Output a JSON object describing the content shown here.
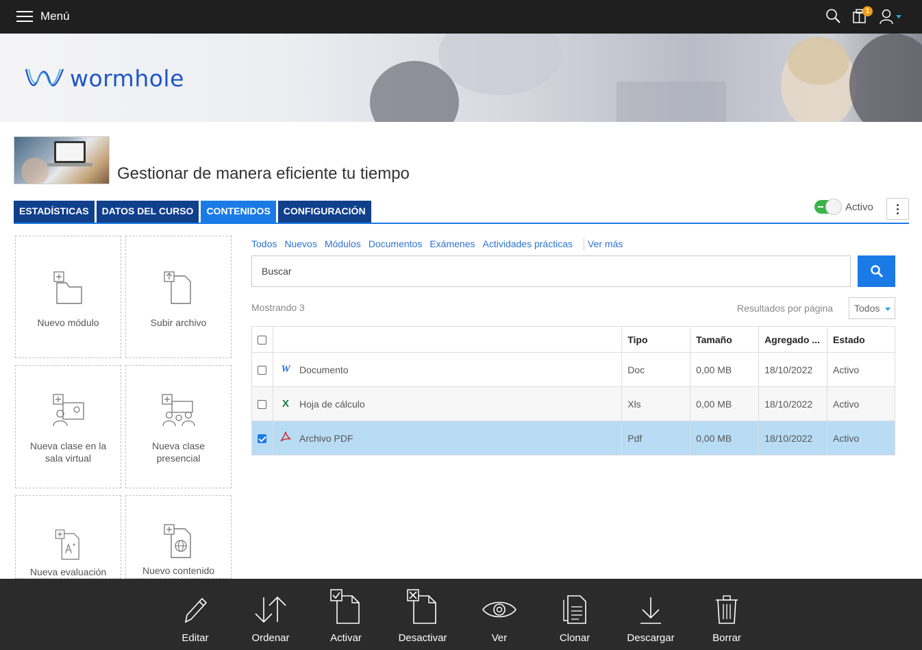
{
  "topbar": {
    "menu_label": "Menú",
    "notification_count": "1"
  },
  "banner": {
    "logo_text": "wormhole"
  },
  "course": {
    "title": "Gestionar de manera eficiente tu tiempo"
  },
  "tabs": [
    {
      "label": "ESTADÍSTICAS",
      "active": false
    },
    {
      "label": "DATOS DEL CURSO",
      "active": false
    },
    {
      "label": "CONTENIDOS",
      "active": true
    },
    {
      "label": "CONFIGURACIÓN",
      "active": false
    }
  ],
  "status_toggle": {
    "label": "Activo",
    "on": true
  },
  "actions": [
    {
      "label": "Nuevo módulo",
      "icon": "new-module-icon"
    },
    {
      "label": "Subir archivo",
      "icon": "upload-file-icon"
    },
    {
      "label": "Nueva clase en la sala virtual",
      "icon": "virtual-class-icon"
    },
    {
      "label": "Nueva clase presencial",
      "icon": "in-person-class-icon"
    },
    {
      "label": "Nueva evaluación",
      "icon": "new-evaluation-icon"
    },
    {
      "label": "Nuevo contenido",
      "icon": "new-content-icon"
    }
  ],
  "filters": [
    "Todos",
    "Nuevos",
    "Módulos",
    "Documentos",
    "Exámenes",
    "Actividades prácticas"
  ],
  "filters_more": "Ver más",
  "search": {
    "placeholder": "Buscar"
  },
  "results": {
    "showing": "Mostrando 3",
    "per_page_label": "Resultados por página",
    "per_page_value": "Todos"
  },
  "table": {
    "headers": [
      "Tipo",
      "Tamaño",
      "Agregado ...",
      "Estado"
    ],
    "rows": [
      {
        "name": "Documento",
        "icon": "word-icon",
        "type": "Doc",
        "size": "0,00 MB",
        "added": "18/10/2022",
        "status": "Activo",
        "checked": false
      },
      {
        "name": "Hoja de cálculo",
        "icon": "excel-icon",
        "type": "Xls",
        "size": "0,00 MB",
        "added": "18/10/2022",
        "status": "Activo",
        "checked": false
      },
      {
        "name": "Archivo PDF",
        "icon": "pdf-icon",
        "type": "Pdf",
        "size": "0,00 MB",
        "added": "18/10/2022",
        "status": "Activo",
        "checked": true
      }
    ]
  },
  "bottom_actions": [
    {
      "label": "Editar",
      "icon": "pencil-icon"
    },
    {
      "label": "Ordenar",
      "icon": "sort-arrows-icon"
    },
    {
      "label": "Activar",
      "icon": "activate-doc-icon"
    },
    {
      "label": "Desactivar",
      "icon": "deactivate-doc-icon"
    },
    {
      "label": "Ver",
      "icon": "eye-icon"
    },
    {
      "label": "Clonar",
      "icon": "clone-icon"
    },
    {
      "label": "Descargar",
      "icon": "download-icon"
    },
    {
      "label": "Borrar",
      "icon": "trash-icon"
    }
  ],
  "colors": {
    "topbar": "#1f1f1f",
    "tab": "#103f8c",
    "tab_active": "#1a7ae6",
    "link": "#2c73d2",
    "selected_row": "#b9dcf5",
    "toggle_on": "#3bb34a",
    "bottombar": "#2b2b2b"
  }
}
